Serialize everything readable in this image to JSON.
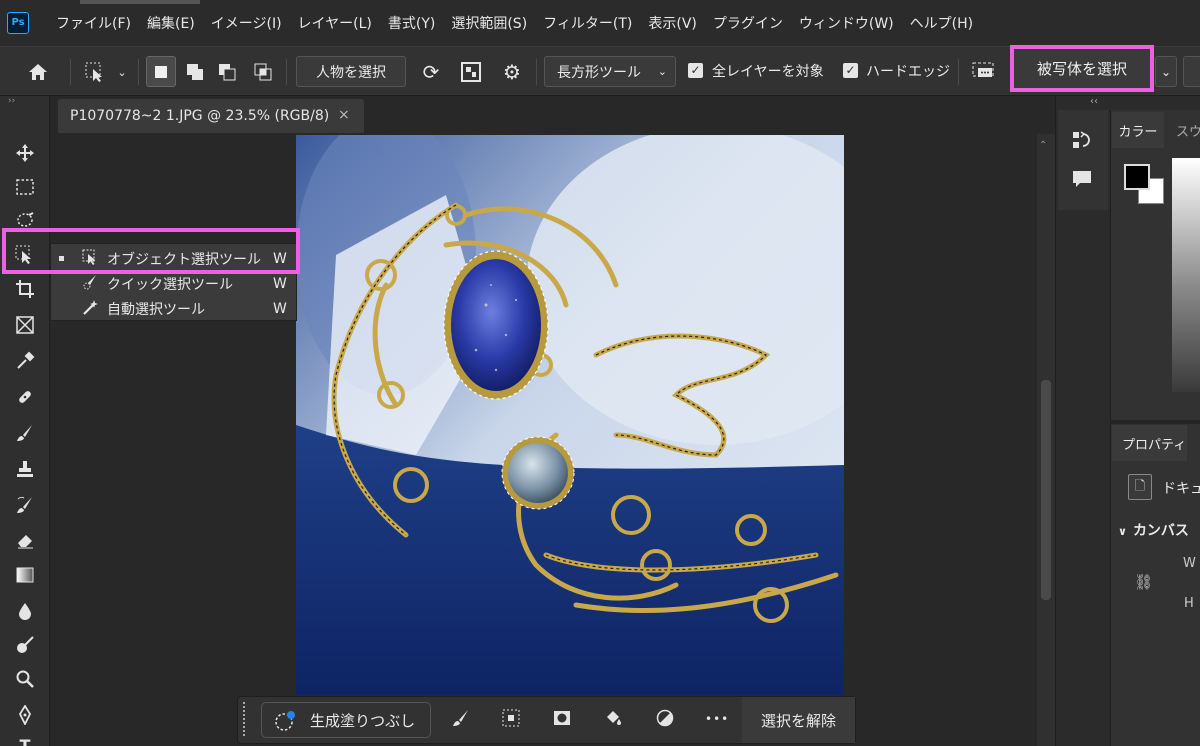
{
  "app": {
    "logo": "Ps"
  },
  "menu": [
    "ファイル(F)",
    "編集(E)",
    "イメージ(I)",
    "レイヤー(L)",
    "書式(Y)",
    "選択範囲(S)",
    "フィルター(T)",
    "表示(V)",
    "プラグイン",
    "ウィンドウ(W)",
    "ヘルプ(H)"
  ],
  "options": {
    "select_people": "人物を選択",
    "mode_dropdown": "長方形ツール",
    "sample_all_layers": "全レイヤーを対象",
    "sample_all_layers_checked": true,
    "hard_edge": "ハードエッジ",
    "hard_edge_checked": true,
    "select_subject": "被写体を選択"
  },
  "document": {
    "tab_title": "P1070778~2 1.JPG @ 23.5% (RGB/8)",
    "close": "×"
  },
  "flyout": {
    "items": [
      {
        "label": "オブジェクト選択ツール",
        "key": "W",
        "icon": "object-select-icon",
        "active": true
      },
      {
        "label": "クイック選択ツール",
        "key": "W",
        "icon": "quick-select-icon",
        "active": false
      },
      {
        "label": "自動選択ツール",
        "key": "W",
        "icon": "magic-wand-icon",
        "active": false
      }
    ]
  },
  "taskbar": {
    "generative_fill": "生成塗りつぶし",
    "deselect": "選択を解除",
    "more": "•••"
  },
  "right_panel": {
    "color_tab": "カラー",
    "swatch_tab": "スウ",
    "properties_tab": "プロパティ",
    "document_label": "ドキュ",
    "canvas_header": "カンバス",
    "w_label": "W",
    "h_label": "H"
  },
  "colors": {
    "highlight": "#ef5fe3",
    "accent": "#31a8ff",
    "foreground": "#000000",
    "background": "#ffffff"
  }
}
